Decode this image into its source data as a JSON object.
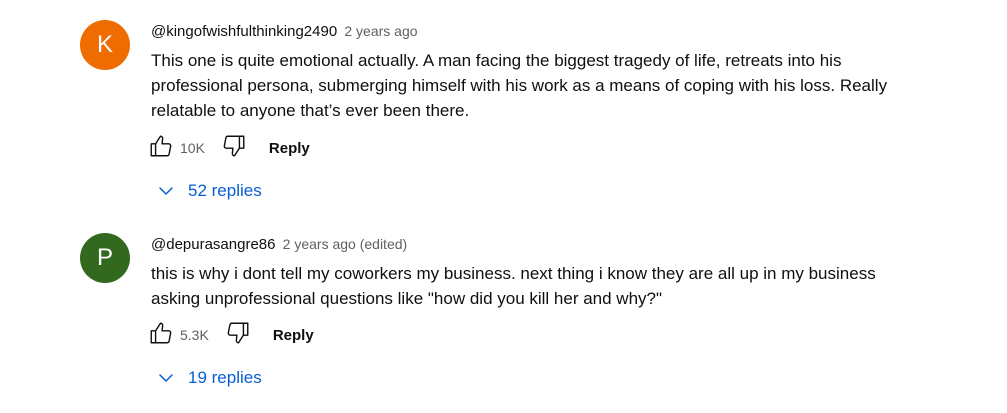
{
  "comments": [
    {
      "avatar_letter": "K",
      "avatar_color": "#ef6c00",
      "author": "@kingofwishfulthinking2490",
      "time": "2 years ago",
      "text_lines": [
        "This one is quite emotional actually. A man facing the biggest tragedy of life, retreats into his",
        "professional persona, submerging himself with his work as a means of coping with his loss. Really",
        "relatable to anyone that’s ever been there."
      ],
      "likes": "10K",
      "reply_label": "Reply",
      "replies_label": "52 replies"
    },
    {
      "avatar_letter": "P",
      "avatar_color": "#33691e",
      "author": "@depurasangre86",
      "time": "2 years ago (edited)",
      "text_lines": [
        "this is why i dont tell my coworkers my business. next thing i know they are all up in my business",
        "asking unprofessional questions like \"how  did you kill her and why?\""
      ],
      "likes": "5.3K",
      "reply_label": "Reply",
      "replies_label": "19 replies"
    }
  ],
  "icons": {
    "like": "thumbs-up-icon",
    "dislike": "thumbs-down-icon",
    "expand": "chevron-down-icon"
  },
  "colors": {
    "link": "#065fd4",
    "meta": "#606060"
  }
}
